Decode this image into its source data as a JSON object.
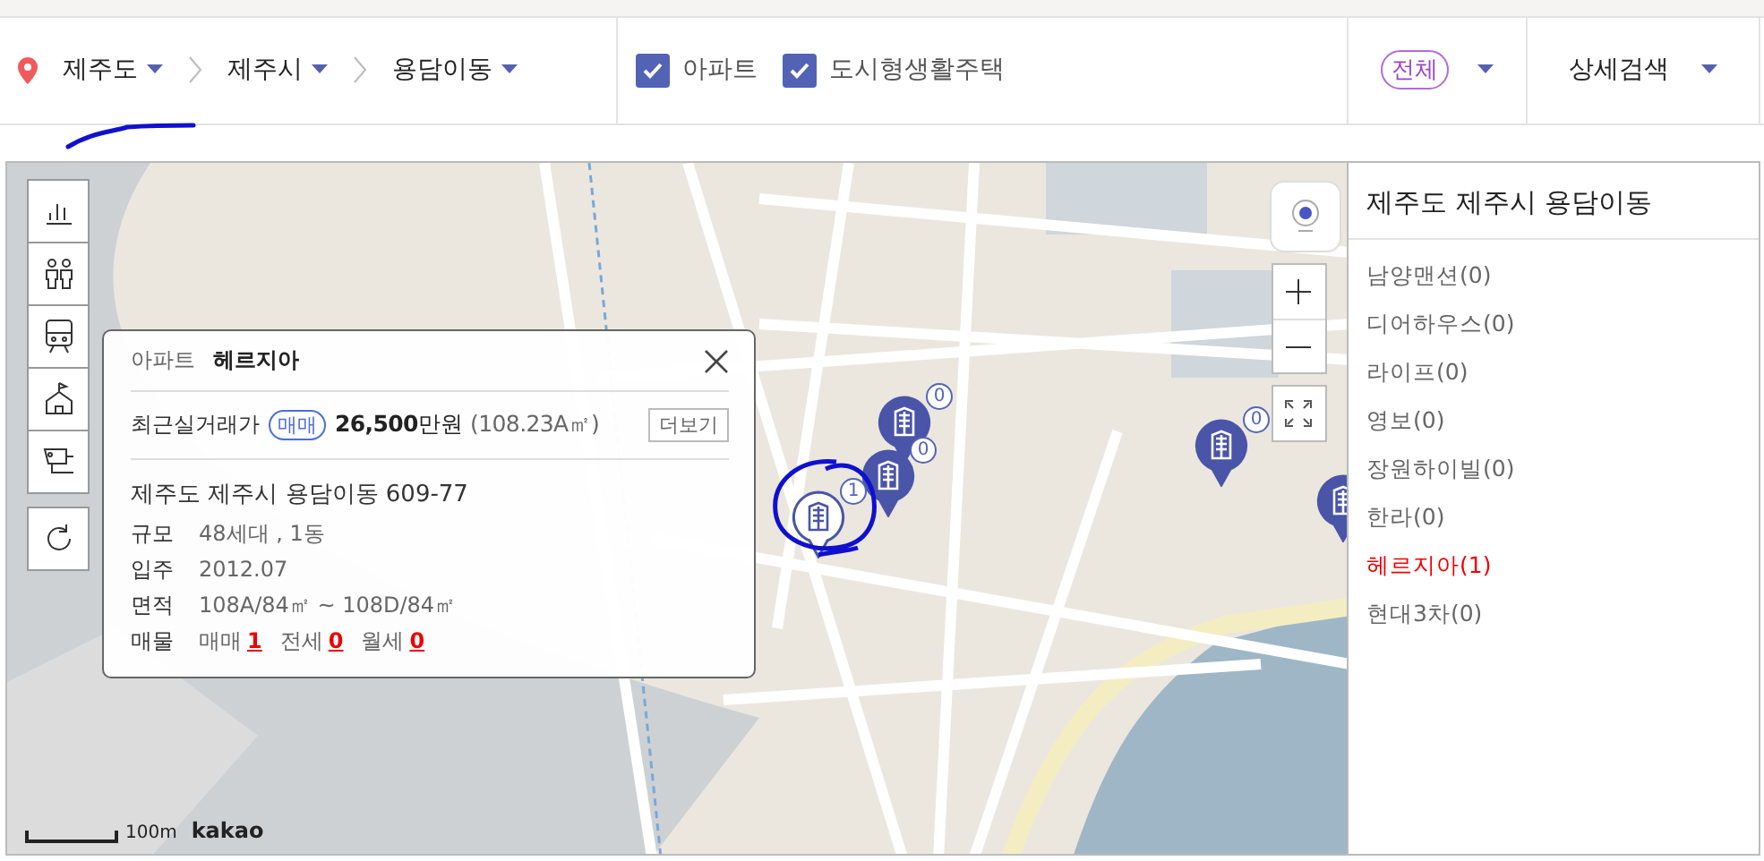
{
  "location": {
    "path": [
      {
        "label": "제주도"
      },
      {
        "label": "제주시"
      },
      {
        "label": "용담이동"
      }
    ]
  },
  "filters": [
    {
      "label": "아파트",
      "checked": true
    },
    {
      "label": "도시형생활주택",
      "checked": true
    }
  ],
  "deal_filter": {
    "label": "전체"
  },
  "detail_search": {
    "label": "상세검색"
  },
  "popup": {
    "type": "아파트",
    "name": "헤르지아",
    "recent_label": "최근실거래가",
    "deal_badge": "매매",
    "price": "26,500",
    "price_unit": "만원",
    "area": "(108.23A㎡)",
    "more": "더보기",
    "address": "제주도 제주시 용담이동 609-77",
    "facts": [
      {
        "label": "규모",
        "value": "48세대 , 1동"
      },
      {
        "label": "입주",
        "value": "2012.07"
      },
      {
        "label": "면적",
        "value": "108A/84㎡ ~ 108D/84㎡"
      }
    ],
    "listings_label": "매물",
    "listings": [
      {
        "label": "매매",
        "count": "1"
      },
      {
        "label": "전세",
        "count": "0"
      },
      {
        "label": "월세",
        "count": "0"
      }
    ]
  },
  "markers": [
    {
      "count": "0",
      "selected": false
    },
    {
      "count": "0",
      "selected": false
    },
    {
      "count": "1",
      "selected": true
    },
    {
      "count": "0",
      "selected": false
    },
    {
      "selected": false
    }
  ],
  "scale": {
    "distance": "100m",
    "brand": "kakao"
  },
  "sidebar": {
    "title": "제주도 제주시 용담이동",
    "items": [
      {
        "label": "남양맨션(0)",
        "selected": false
      },
      {
        "label": "디어하우스(0)",
        "selected": false
      },
      {
        "label": "라이프(0)",
        "selected": false
      },
      {
        "label": "영보(0)",
        "selected": false
      },
      {
        "label": "장원하이빌(0)",
        "selected": false
      },
      {
        "label": "한라(0)",
        "selected": false
      },
      {
        "label": "헤르지아(1)",
        "selected": true
      },
      {
        "label": "현대3차(0)",
        "selected": false
      }
    ]
  }
}
